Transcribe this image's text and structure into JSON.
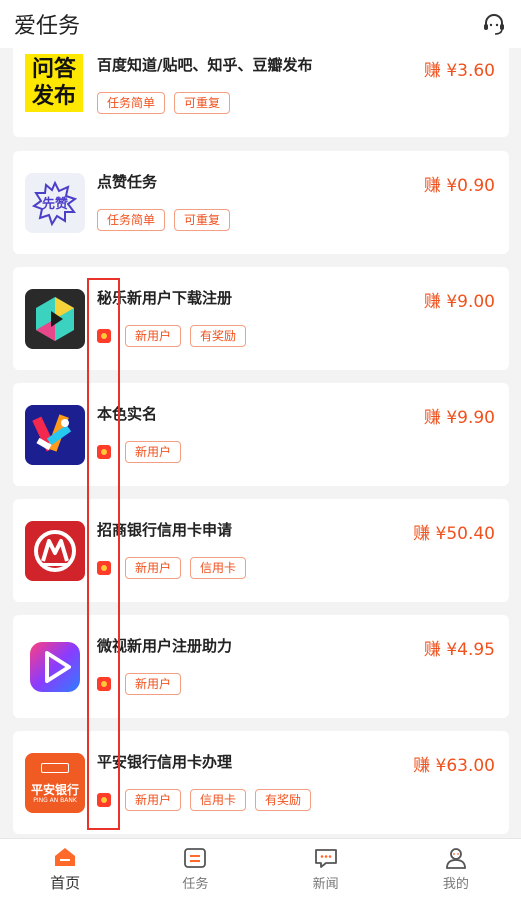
{
  "header": {
    "title": "爱任务"
  },
  "tasks": [
    {
      "name": "百度知道/贴吧、知乎、豆瓣发布",
      "reward": "赚 ¥3.60",
      "logo_text_1": "问答",
      "logo_text_2": "发布",
      "tags": [
        "任务简单",
        "可重复"
      ],
      "has_redpack": false
    },
    {
      "name": "点赞任务",
      "reward": "赚 ¥0.90",
      "logo_text": "先赞",
      "tags": [
        "任务简单",
        "可重复"
      ],
      "has_redpack": false
    },
    {
      "name": "秘乐新用户下载注册",
      "reward": "赚 ¥9.00",
      "tags": [
        "新用户",
        "有奖励"
      ],
      "has_redpack": true
    },
    {
      "name": "本色实名",
      "reward": "赚 ¥9.90",
      "tags": [
        "新用户"
      ],
      "has_redpack": true
    },
    {
      "name": "招商银行信用卡申请",
      "reward": "赚 ¥50.40",
      "tags": [
        "新用户",
        "信用卡"
      ],
      "has_redpack": true
    },
    {
      "name": "微视新用户注册助力",
      "reward": "赚 ¥4.95",
      "tags": [
        "新用户"
      ],
      "has_redpack": true
    },
    {
      "name": "平安银行信用卡办理",
      "reward": "赚 ¥63.00",
      "logo_text_1": "平安银行",
      "logo_text_2": "PING AN BANK",
      "tags": [
        "新用户",
        "信用卡",
        "有奖励"
      ],
      "has_redpack": true
    }
  ],
  "tabbar": [
    {
      "label": "首页",
      "icon": "home-icon",
      "active": true
    },
    {
      "label": "任务",
      "icon": "task-list-icon",
      "active": false
    },
    {
      "label": "新闻",
      "icon": "news-chat-icon",
      "active": false
    },
    {
      "label": "我的",
      "icon": "profile-icon",
      "active": false
    }
  ],
  "colors": {
    "accent": "#f0521e",
    "tag_border": "#f59f82",
    "highlight": "#e8322a"
  }
}
